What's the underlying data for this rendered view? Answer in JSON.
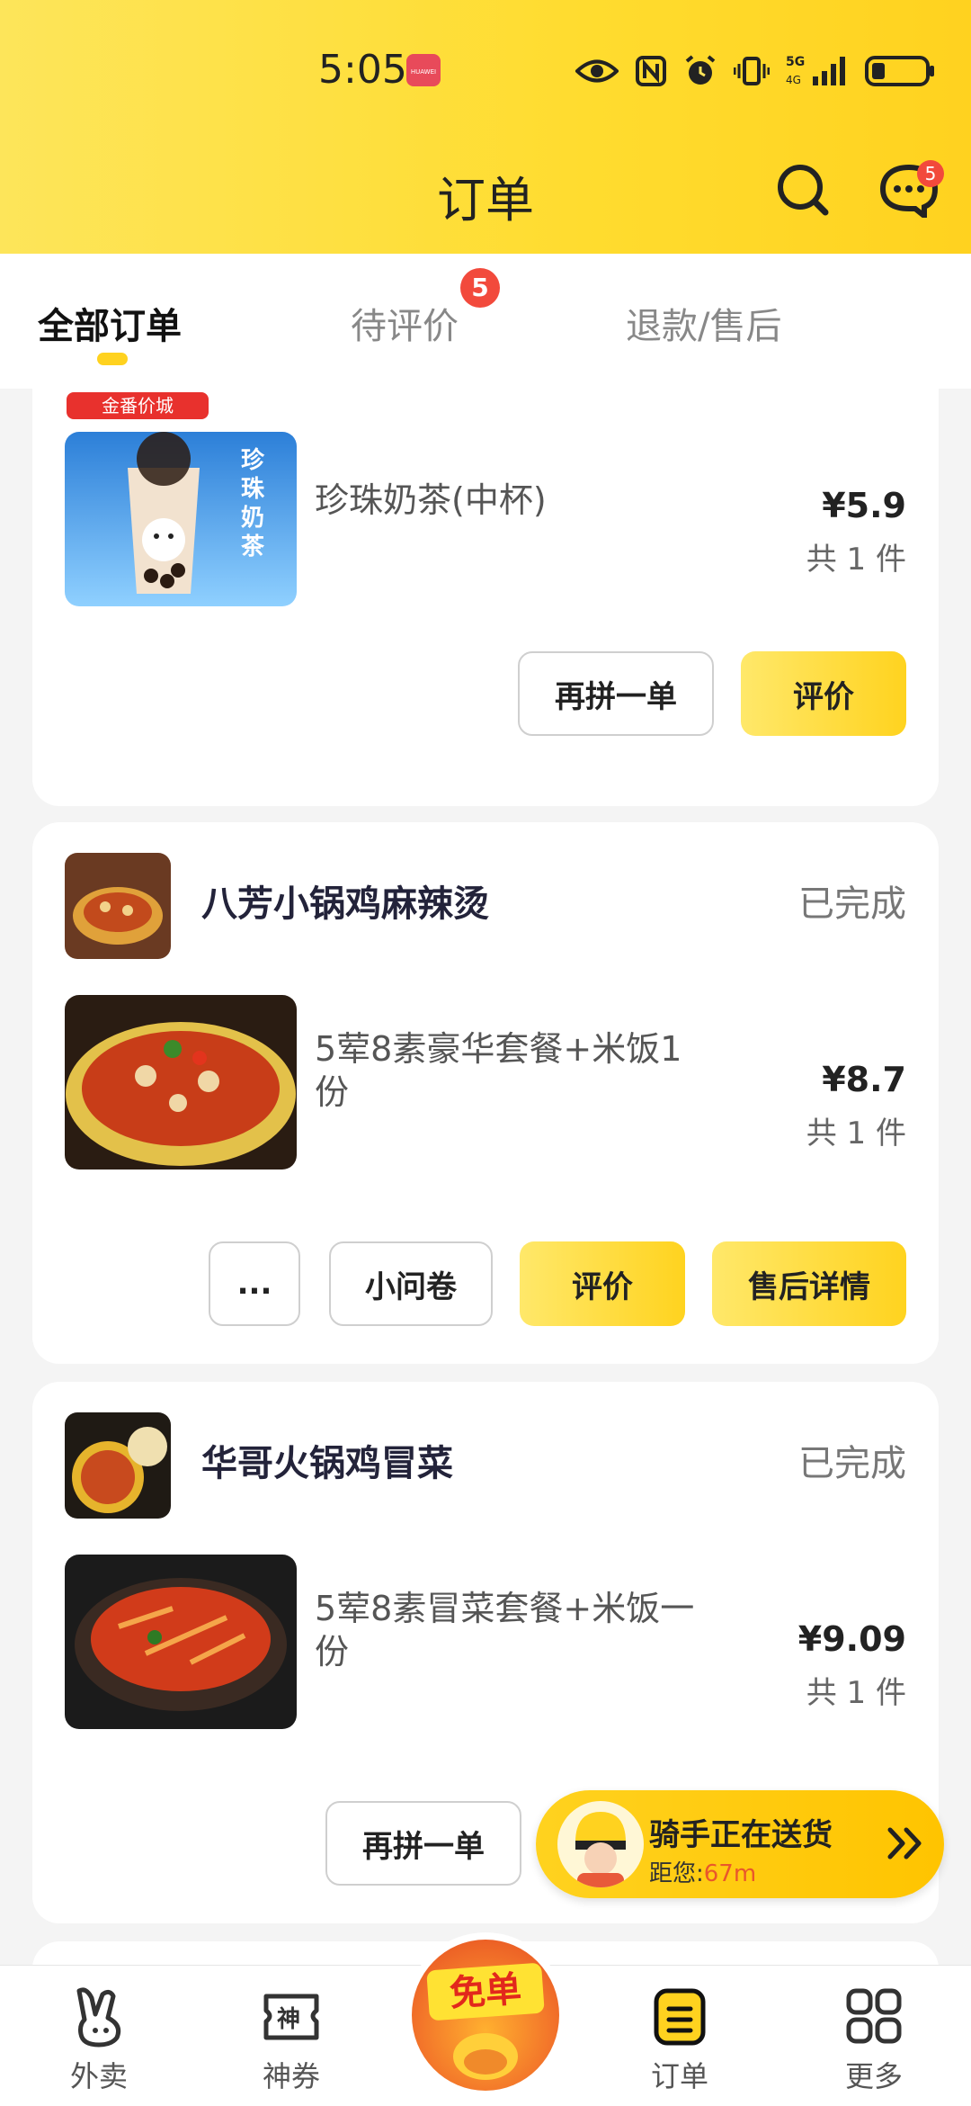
{
  "status_bar": {
    "time": "5:05",
    "brand": "HUAWEI",
    "network": "5G"
  },
  "header": {
    "title": "订单",
    "message_badge": "5"
  },
  "tabs": [
    {
      "label": "全部订单",
      "active": true
    },
    {
      "label": "待评价",
      "badge": "5"
    },
    {
      "label": "退款/售后"
    }
  ],
  "orders": [
    {
      "shop_badge": "金番价城",
      "item": {
        "name": "珍珠奶茶(中杯)",
        "price": "¥5.9",
        "count": "共 1 件",
        "image_icon": "bubble-tea-image"
      },
      "buttons": [
        {
          "label": "再拼一单",
          "style": "outline"
        },
        {
          "label": "评价",
          "style": "primary"
        }
      ]
    },
    {
      "shop": "八芳小锅鸡麻辣烫",
      "status": "已完成",
      "item": {
        "name": "5荤8素豪华套餐+米饭1份",
        "price": "¥8.7",
        "count": "共 1 件",
        "image_icon": "malatang-image"
      },
      "buttons": [
        {
          "label": "...",
          "style": "outline"
        },
        {
          "label": "小问卷",
          "style": "outline"
        },
        {
          "label": "评价",
          "style": "primary"
        },
        {
          "label": "售后详情",
          "style": "primary"
        }
      ]
    },
    {
      "shop": "华哥火锅鸡冒菜",
      "status": "已完成",
      "item": {
        "name": "5荤8素冒菜套餐+米饭一份",
        "price": "¥9.09",
        "count": "共 1 件",
        "image_icon": "maocai-image"
      },
      "buttons": [
        {
          "label": "再拼一单",
          "style": "outline"
        }
      ]
    }
  ],
  "rider": {
    "title": "骑手正在送货",
    "distance_label": "距您:",
    "distance": "67m"
  },
  "bottom_nav": [
    {
      "label": "外卖",
      "icon": "rabbit-icon"
    },
    {
      "label": "神券",
      "icon": "coupon-icon"
    },
    {
      "label": "免单",
      "icon": "free-order-icon"
    },
    {
      "label": "订单",
      "icon": "order-icon",
      "active": true
    },
    {
      "label": "更多",
      "icon": "grid-icon"
    }
  ],
  "colors": {
    "brand_yellow": "#ffd21f",
    "badge_red": "#f24a3c",
    "accent_orange": "#e9572b"
  }
}
